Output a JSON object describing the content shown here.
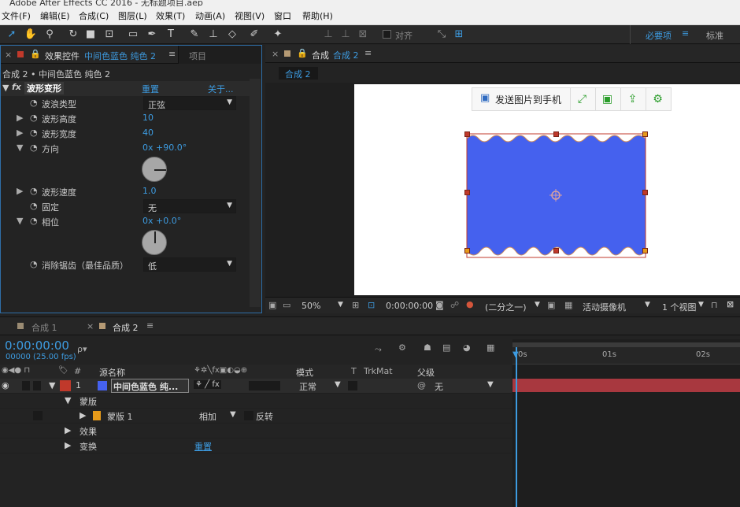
{
  "window": {
    "title": "Adobe After Effects CC 2016 - 无标题项目.aep"
  },
  "menu": [
    "文件(F)",
    "编辑(E)",
    "合成(C)",
    "图层(L)",
    "效果(T)",
    "动画(A)",
    "视图(V)",
    "窗口",
    "帮助(H)"
  ],
  "toolbar": {
    "align_label": "对齐",
    "workspace_essentials": "必要项",
    "workspace_standard": "标准",
    "workspace_menu_icon": "≡"
  },
  "effects_panel": {
    "tab_prefix": "效果控件",
    "tab_layer": "中间色蓝色 纯色 2",
    "tab_menu_icon": "≡",
    "tab_project": "项目",
    "breadcrumb": "合成 2 • 中间色蓝色 纯色 2",
    "effect_name": "波形变形",
    "reset": "重置",
    "about": "关于...",
    "props": [
      {
        "label": "波浪类型",
        "value": "正弦",
        "kind": "dropdown"
      },
      {
        "label": "波形高度",
        "value": "10",
        "kind": "number"
      },
      {
        "label": "波形宽度",
        "value": "40",
        "kind": "number"
      },
      {
        "label": "方向",
        "value": "0x +90.0°",
        "kind": "dial"
      },
      {
        "label": "波形速度",
        "value": "1.0",
        "kind": "number"
      },
      {
        "label": "固定",
        "value": "无",
        "kind": "dropdown"
      },
      {
        "label": "相位",
        "value": "0x +0.0°",
        "kind": "dial"
      },
      {
        "label": "消除锯齿（最佳品质）",
        "value": "低",
        "kind": "dropdown"
      }
    ]
  },
  "comp_panel": {
    "tab_label": "合成",
    "tab_comp": "合成 2",
    "tab_menu_icon": "≡",
    "subtab": "合成 2",
    "floating_toolbar": {
      "send_label": "发送图片到手机"
    },
    "shape_color": "#4561ee",
    "bottom_bar": {
      "zoom": "50%",
      "timecode": "0:00:00:00",
      "resolution": "(二分之一)",
      "camera": "活动摄像机",
      "views": "1 个视图"
    }
  },
  "timeline": {
    "tabs": [
      {
        "label": "合成 1"
      },
      {
        "label": "合成 2",
        "active": true
      }
    ],
    "tab_menu_icon": "≡",
    "timecode": "0:00:00:00",
    "fps": "00000 (25.00 fps)",
    "search_placeholder": "ρ▾",
    "columns": {
      "num": "#",
      "source": "源名称",
      "mode": "模式",
      "t": "T",
      "trkmat": "TrkMat",
      "parent": "父级"
    },
    "layer": {
      "index": "1",
      "name": "中间色蓝色 纯...",
      "mode": "正常",
      "parent": "无",
      "color": "#c0392b"
    },
    "mask_group": "蒙版",
    "mask": {
      "name": "蒙版 1",
      "mode": "相加",
      "invert": "反转",
      "color": "#e69a1a"
    },
    "effects_group": "效果",
    "transform_group": "变换",
    "transform_reset": "重置",
    "ruler_ticks": [
      {
        "label": "0s"
      },
      {
        "label": "01s"
      },
      {
        "label": "02s"
      }
    ],
    "track_color": "#a8383f"
  }
}
